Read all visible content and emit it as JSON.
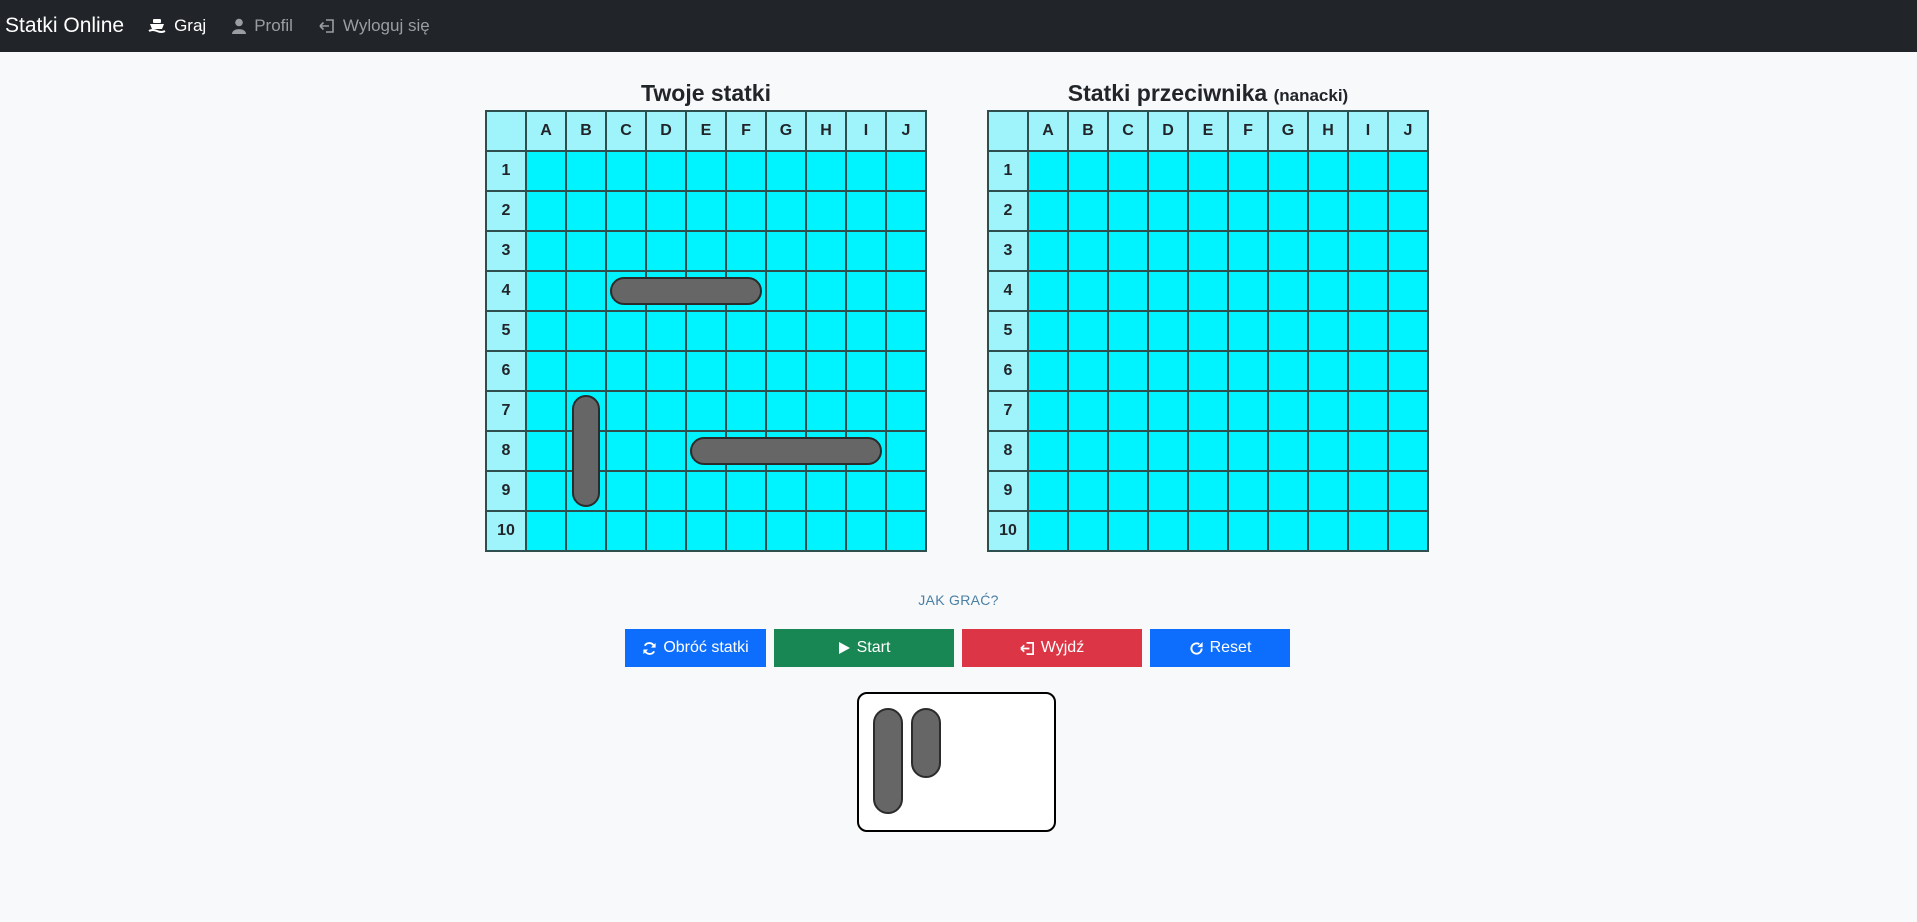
{
  "navbar": {
    "brand": "Statki Online",
    "items": [
      {
        "label": "Graj",
        "icon": "ship-icon",
        "active": true
      },
      {
        "label": "Profil",
        "icon": "user-icon",
        "active": false
      },
      {
        "label": "Wyloguj się",
        "icon": "logout-icon",
        "active": false
      }
    ]
  },
  "boards": {
    "columns": [
      "A",
      "B",
      "C",
      "D",
      "E",
      "F",
      "G",
      "H",
      "I",
      "J"
    ],
    "rows": [
      "1",
      "2",
      "3",
      "4",
      "5",
      "6",
      "7",
      "8",
      "9",
      "10"
    ],
    "player": {
      "title": "Twoje statki",
      "ships": [
        {
          "start": "C4",
          "length": 4,
          "orientation": "horizontal"
        },
        {
          "start": "B7",
          "length": 3,
          "orientation": "vertical"
        },
        {
          "start": "E8",
          "length": 5,
          "orientation": "horizontal"
        }
      ]
    },
    "opponent": {
      "title": "Statki przeciwnika",
      "subtitle": "(nanacki)"
    }
  },
  "controls": {
    "howto": "JAK GRAĆ?",
    "rotate": "Obróć statki",
    "start": "Start",
    "exit": "Wyjdź",
    "reset": "Reset"
  },
  "dock": {
    "ships": [
      {
        "length": 3,
        "orientation": "vertical"
      },
      {
        "length": 2,
        "orientation": "vertical"
      }
    ]
  },
  "colors": {
    "navbar": "#212529",
    "water": "#00f4ff",
    "header_cell": "#9ff4fb",
    "ship": "#666666",
    "primary": "#0d6efd",
    "success": "#198754",
    "danger": "#dc3545"
  }
}
